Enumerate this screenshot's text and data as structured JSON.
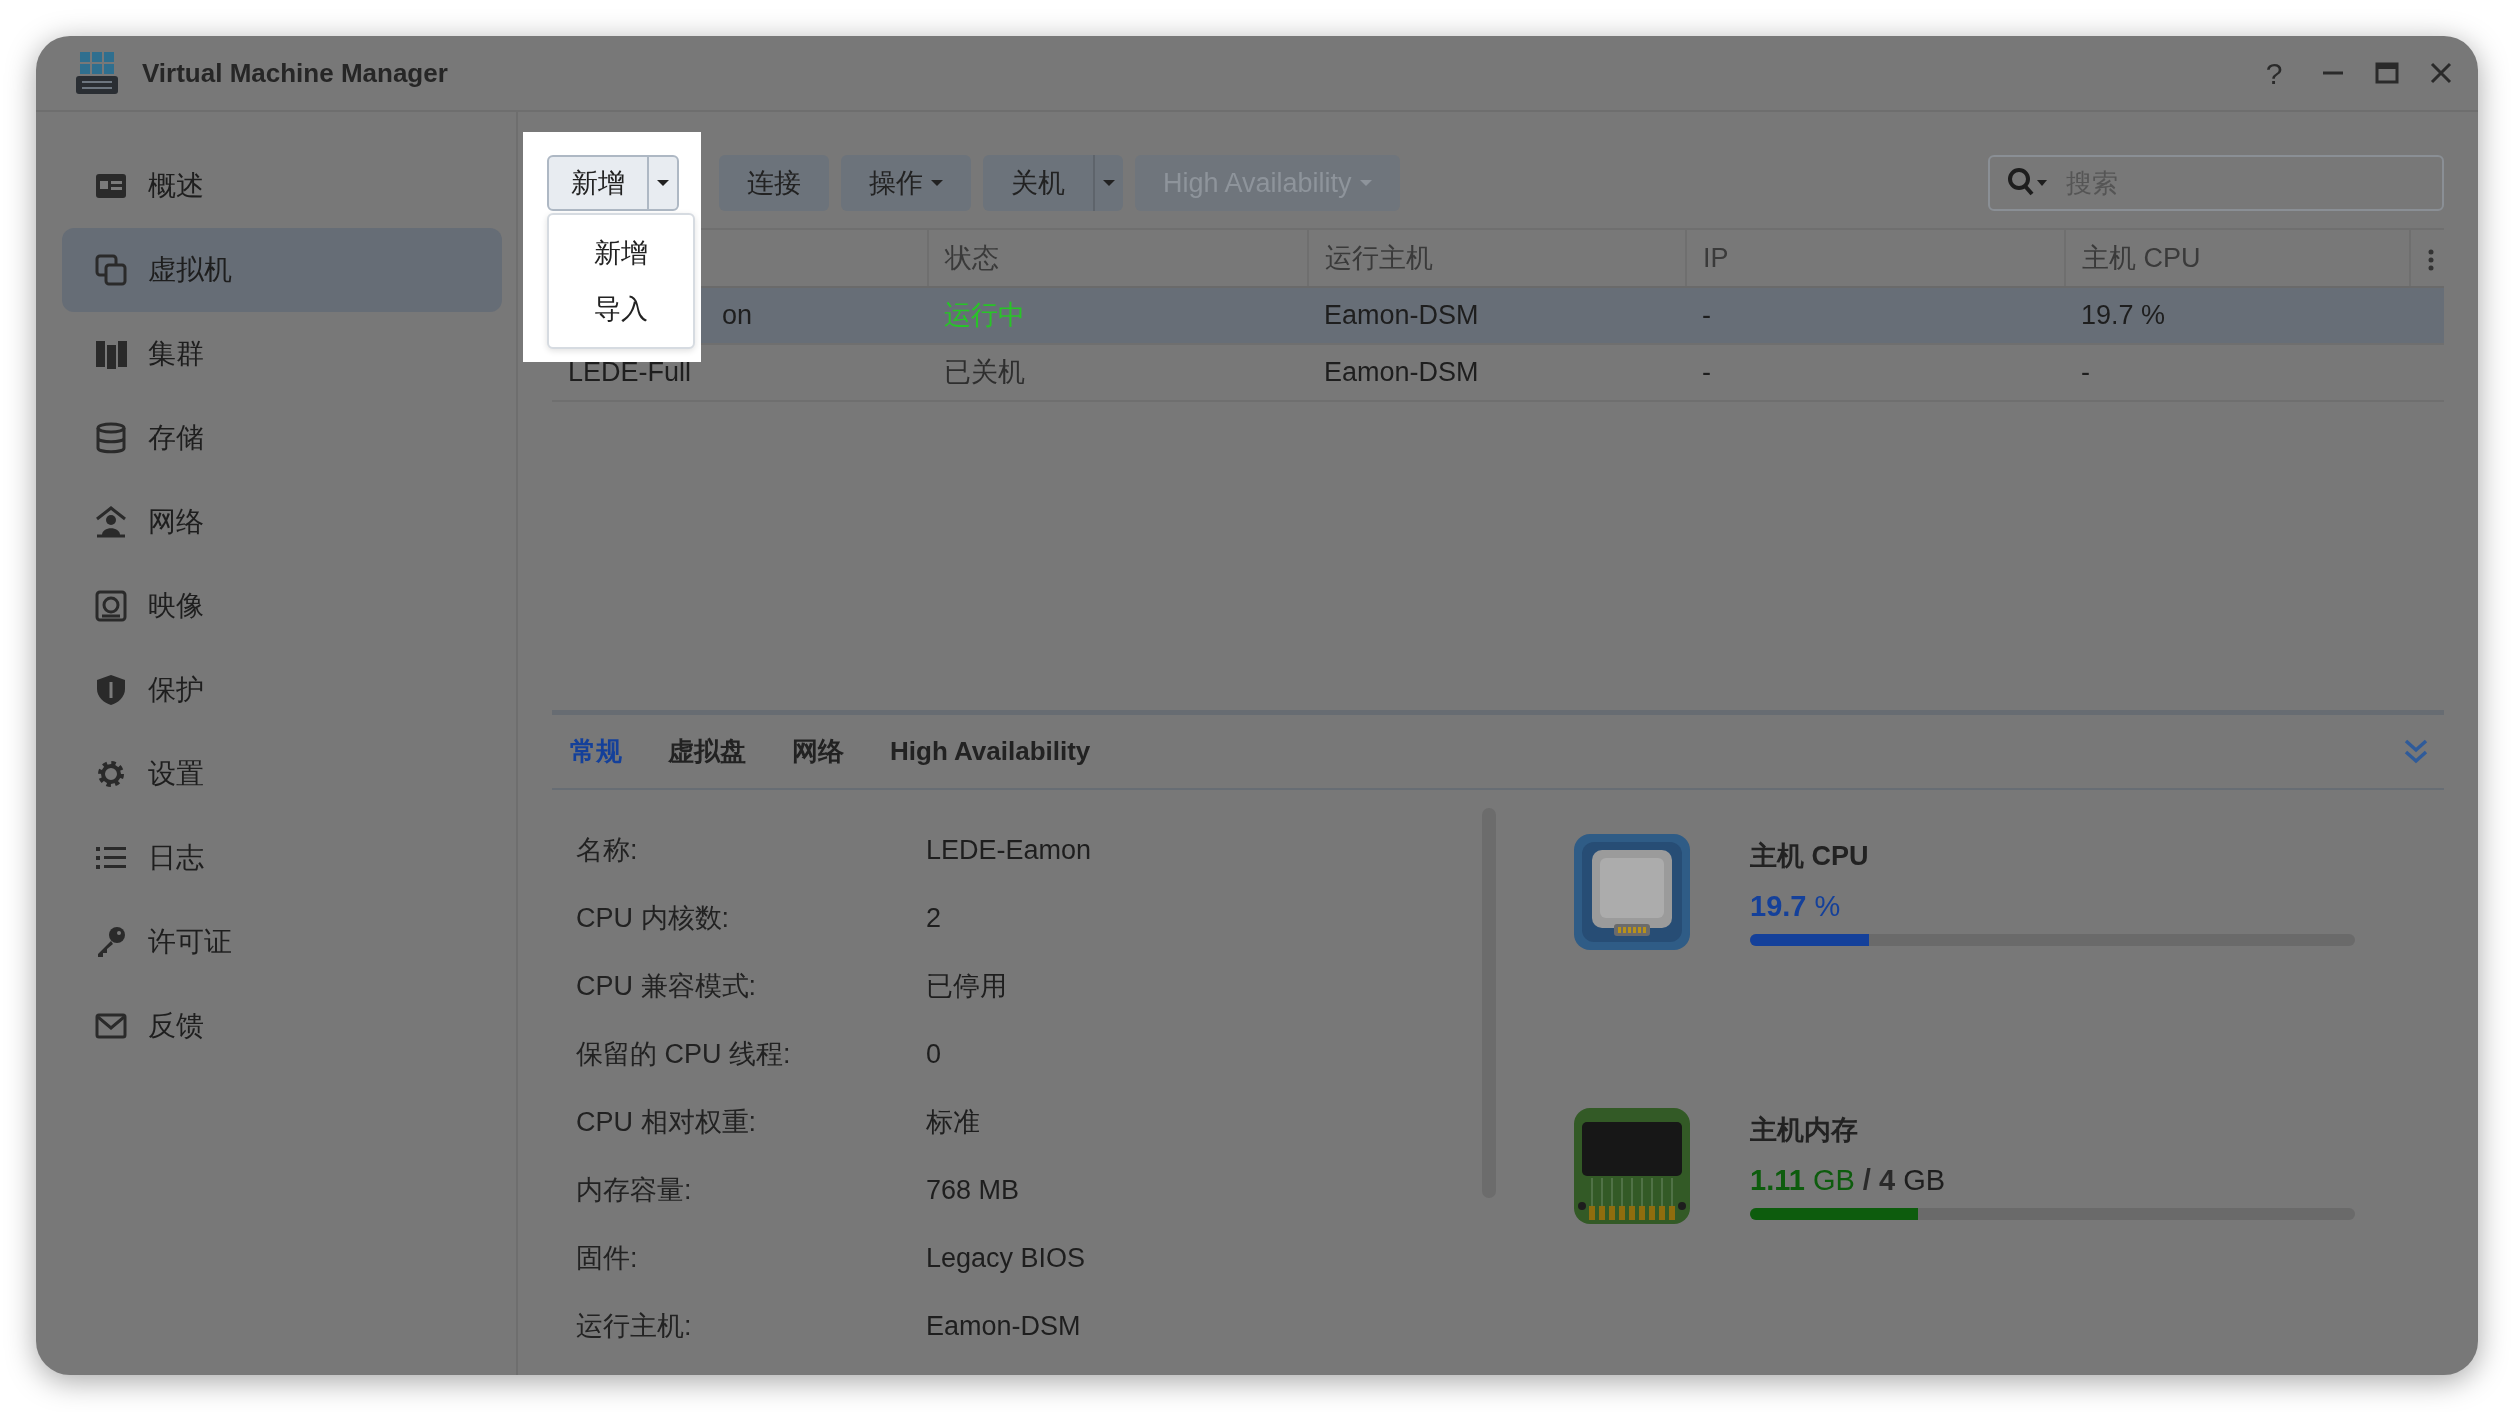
{
  "window": {
    "title": "Virtual Machine Manager",
    "help": "?"
  },
  "sidebar": {
    "items": [
      {
        "label": "概述",
        "selected": false
      },
      {
        "label": "虚拟机",
        "selected": true
      },
      {
        "label": "集群",
        "selected": false
      },
      {
        "label": "存储",
        "selected": false
      },
      {
        "label": "网络",
        "selected": false
      },
      {
        "label": "映像",
        "selected": false
      },
      {
        "label": "保护",
        "selected": false
      },
      {
        "label": "设置",
        "selected": false
      },
      {
        "label": "日志",
        "selected": false
      },
      {
        "label": "许可证",
        "selected": false
      },
      {
        "label": "反馈",
        "selected": false
      }
    ]
  },
  "toolbar": {
    "buttons": [
      {
        "label": "新增",
        "kind": "split",
        "disabled": false
      },
      {
        "label": "连接",
        "kind": "plain",
        "disabled": false
      },
      {
        "label": "操作",
        "kind": "dropdown",
        "disabled": false
      },
      {
        "label": "关机",
        "kind": "split",
        "disabled": false
      },
      {
        "label": "High Availability",
        "kind": "dropdown",
        "disabled": true
      }
    ],
    "menu": {
      "items": [
        "新增",
        "导入"
      ]
    },
    "search": {
      "placeholder": "搜索"
    }
  },
  "table": {
    "columns": [
      "状态",
      "运行主机",
      "IP",
      "主机 CPU"
    ],
    "rows": [
      {
        "name": "on",
        "status": "运行中",
        "color": "#28c428",
        "host": "Eamon-DSM",
        "ip": "-",
        "cpu": "19.7 %",
        "selected": true
      },
      {
        "name": "LEDE-Full",
        "status": "已关机",
        "color": "#2e2e2e",
        "host": "Eamon-DSM",
        "ip": "-",
        "cpu": "-",
        "selected": false
      }
    ]
  },
  "details": {
    "tabs": [
      {
        "label": "常规",
        "selected": true
      },
      {
        "label": "虚拟盘",
        "selected": false
      },
      {
        "label": "网络",
        "selected": false
      },
      {
        "label": "High Availability",
        "selected": false
      }
    ],
    "fields": [
      {
        "label": "名称:",
        "value": "LEDE-Eamon"
      },
      {
        "label": "CPU 内核数:",
        "value": "2"
      },
      {
        "label": "CPU 兼容模式:",
        "value": "已停用"
      },
      {
        "label": "保留的 CPU 线程:",
        "value": "0"
      },
      {
        "label": "CPU 相对权重:",
        "value": "标准"
      },
      {
        "label": "内存容量:",
        "value": "768 MB"
      },
      {
        "label": "固件:",
        "value": "Legacy BIOS"
      },
      {
        "label": "运行主机:",
        "value": "Eamon-DSM"
      }
    ],
    "monitors": [
      {
        "kind": "cpu",
        "title": "主机 CPU",
        "value": "19.7",
        "unit": "%",
        "level": 0.197
      },
      {
        "kind": "memory",
        "title": "主机内存",
        "value": "1.11",
        "unit": "GB",
        "separator": "/",
        "total": "4",
        "total_unit": "GB",
        "level": 0.2775
      }
    ]
  }
}
